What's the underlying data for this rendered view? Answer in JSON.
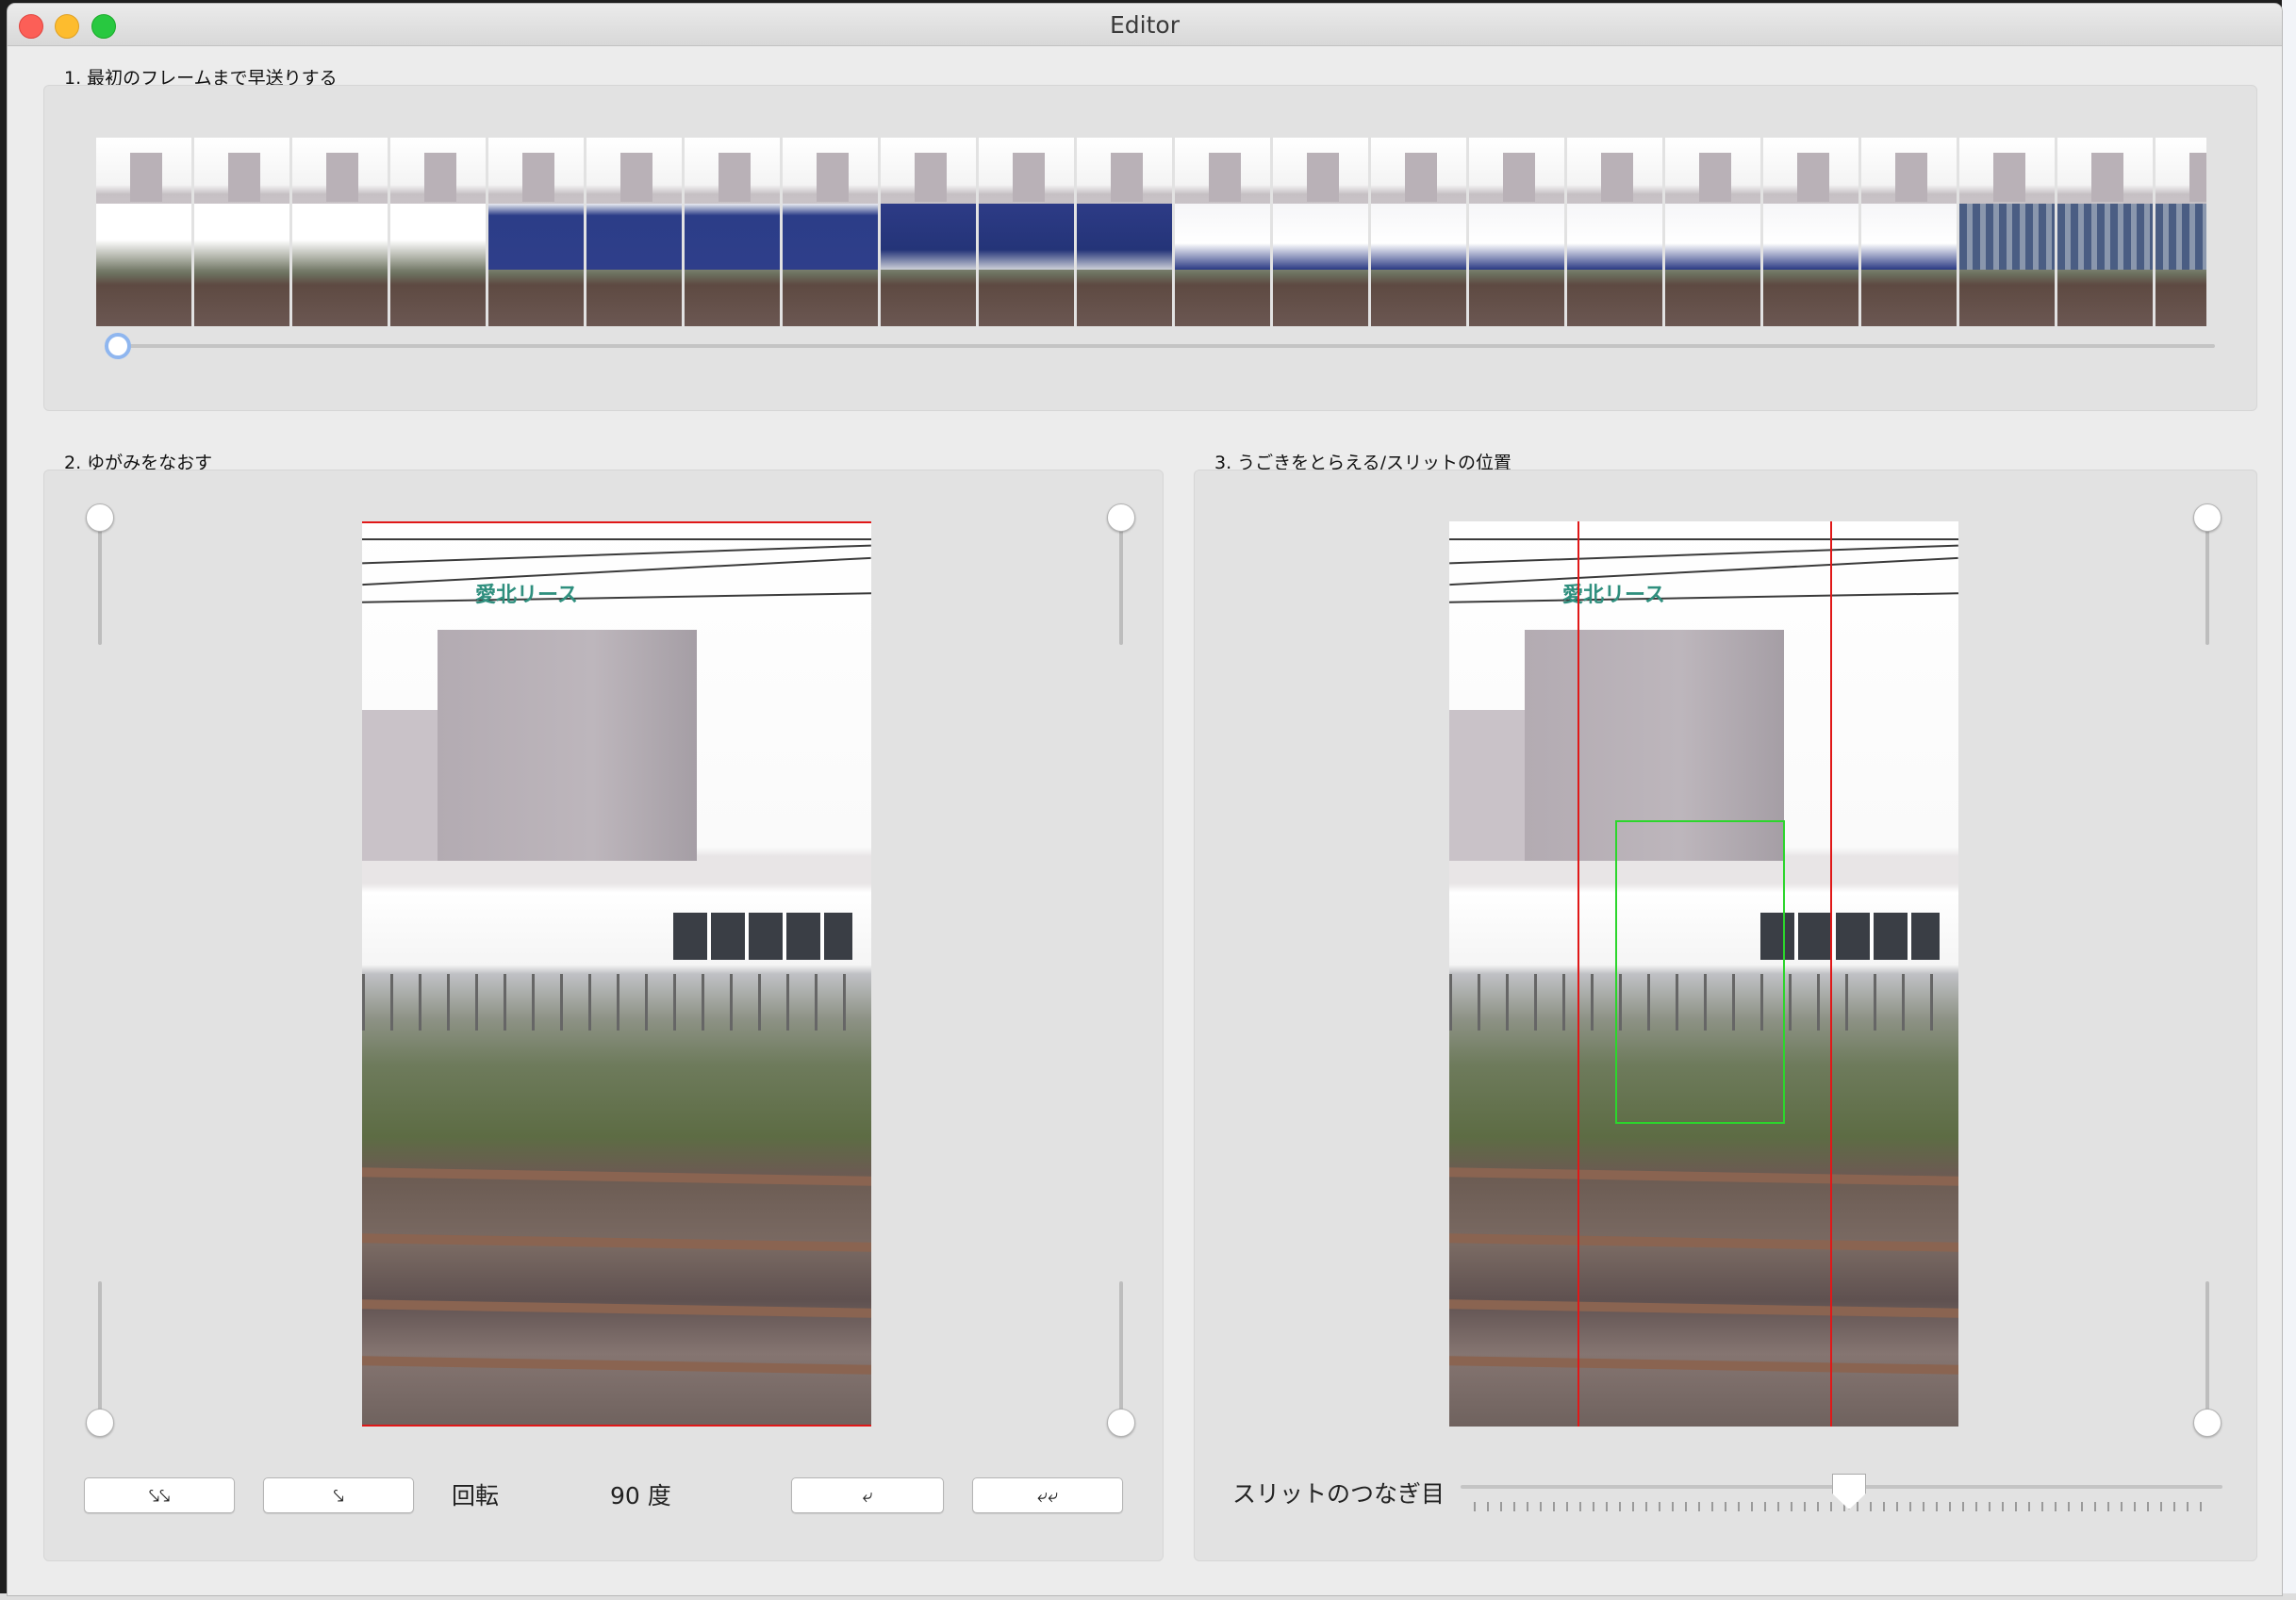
{
  "window": {
    "title": "Editor"
  },
  "section1": {
    "title": "1. 最初のフレームまで早送りする"
  },
  "section2": {
    "title": "2. ゆがみをなおす",
    "buttons": {
      "rotate_left_double": "⤥⤥",
      "rotate_left": "⤥",
      "rotate_right": "⤶",
      "rotate_right_double": "⤶⤶"
    },
    "rotation_label": "回転",
    "rotation_value": "90 度"
  },
  "section3": {
    "title": "3. うごきをとらえる/スリットの位置",
    "slit_seam_label": "スリットのつなぎ目"
  },
  "photo": {
    "sign_text": "愛北リース"
  },
  "icons": {
    "close": "close-icon",
    "minimize": "minimize-icon",
    "maximize": "maximize-icon"
  }
}
